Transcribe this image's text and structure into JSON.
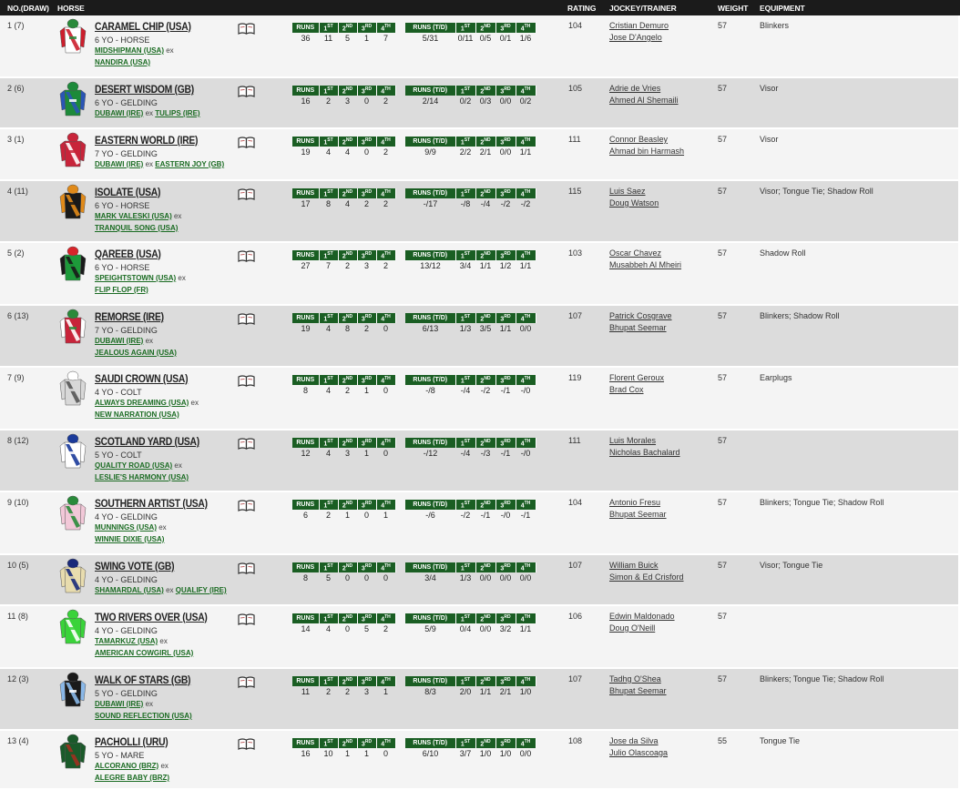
{
  "headers": {
    "no": "NO.(DRAW)",
    "horse": "HORSE",
    "rating": "RATING",
    "jockey": "JOCKEY/TRAINER",
    "weight": "WEIGHT",
    "equipment": "EQUIPMENT"
  },
  "stat_headers": {
    "runs": "RUNS",
    "runs_td": "RUNS (T/D)",
    "first": "1",
    "second": "2",
    "third": "3",
    "fourth": "4",
    "first_sup": "ST",
    "second_sup": "ND",
    "third_sup": "RD",
    "fourth_sup": "TH"
  },
  "sire_dam_joiner": "ex",
  "runners": [
    {
      "no": "1 (7)",
      "name": "CARAMEL CHIP (USA)",
      "age": "6 YO - HORSE",
      "sire": "MIDSHIPMAN (USA)",
      "dam": "NANDIRA (USA)",
      "split": true,
      "stats": [
        "36",
        "11",
        "5",
        "1",
        "7"
      ],
      "td": [
        "5/31",
        "0/11",
        "0/5",
        "0/1",
        "1/6"
      ],
      "rating": "104",
      "jockey": "Cristian Demuro",
      "trainer": "Jose D'Angelo",
      "weight": "57",
      "equipment": "Blinkers",
      "silk": {
        "body": "#ffffff",
        "accent": "#cc1f2d",
        "accent2": "#2a8a3a",
        "cap": "#2a8a3a",
        "arms": "#cc1f2d"
      }
    },
    {
      "no": "2 (6)",
      "name": "DESERT WISDOM (GB)",
      "age": "6 YO - GELDING",
      "sire": "DUBAWI (IRE)",
      "dam": "TULIPS (IRE)",
      "split": false,
      "stats": [
        "16",
        "2",
        "3",
        "0",
        "2"
      ],
      "td": [
        "2/14",
        "0/2",
        "0/3",
        "0/0",
        "0/2"
      ],
      "rating": "105",
      "jockey": "Adrie de Vries",
      "trainer": "Ahmed Al Shemaili",
      "weight": "57",
      "equipment": "Visor",
      "silk": {
        "body": "#1d8a3a",
        "accent": "#2a55b5",
        "accent2": "#ffffff",
        "cap": "#1d8a3a",
        "arms": "#2a55b5"
      }
    },
    {
      "no": "3 (1)",
      "name": "EASTERN WORLD (IRE)",
      "age": "7 YO - GELDING",
      "sire": "DUBAWI (IRE)",
      "dam": "EASTERN JOY (GB)",
      "split": false,
      "stats": [
        "19",
        "4",
        "4",
        "0",
        "2"
      ],
      "td": [
        "9/9",
        "2/2",
        "2/1",
        "0/0",
        "1/1"
      ],
      "rating": "111",
      "jockey": "Connor Beasley",
      "trainer": "Ahmad bin Harmash",
      "weight": "57",
      "equipment": "Visor",
      "silk": {
        "body": "#c8243a",
        "accent": "#ffffff",
        "accent2": "#c8243a",
        "cap": "#c8243a",
        "arms": "#c8243a"
      }
    },
    {
      "no": "4 (11)",
      "name": "ISOLATE (USA)",
      "age": "6 YO - HORSE",
      "sire": "MARK VALESKI (USA)",
      "dam": "TRANQUIL SONG (USA)",
      "split": true,
      "stats": [
        "17",
        "8",
        "4",
        "2",
        "2"
      ],
      "td": [
        "-/17",
        "-/8",
        "-/4",
        "-/2",
        "-/2"
      ],
      "rating": "115",
      "jockey": "Luis Saez",
      "trainer": "Doug Watson",
      "weight": "57",
      "equipment": "Visor; Tongue Tie; Shadow Roll",
      "silk": {
        "body": "#1a1a1a",
        "accent": "#e08a1a",
        "accent2": "#1a1a1a",
        "cap": "#e08a1a",
        "arms": "#e08a1a"
      }
    },
    {
      "no": "5 (2)",
      "name": "QAREEB (USA)",
      "age": "6 YO - HORSE",
      "sire": "SPEIGHTSTOWN (USA)",
      "dam": "FLIP FLOP (FR)",
      "split": true,
      "stats": [
        "27",
        "7",
        "2",
        "3",
        "2"
      ],
      "td": [
        "13/12",
        "3/4",
        "1/1",
        "1/2",
        "1/1"
      ],
      "rating": "103",
      "jockey": "Oscar Chavez",
      "trainer": "Musabbeh Al Mheiri",
      "weight": "57",
      "equipment": "Shadow Roll",
      "silk": {
        "body": "#1d9a3a",
        "accent": "#1a1a1a",
        "accent2": "#1d9a3a",
        "cap": "#d8242a",
        "arms": "#1a1a1a"
      }
    },
    {
      "no": "6 (13)",
      "name": "REMORSE (IRE)",
      "age": "7 YO - GELDING",
      "sire": "DUBAWI (IRE)",
      "dam": "JEALOUS AGAIN (USA)",
      "split": true,
      "stats": [
        "19",
        "4",
        "8",
        "2",
        "0"
      ],
      "td": [
        "6/13",
        "1/3",
        "3/5",
        "1/1",
        "0/0"
      ],
      "rating": "107",
      "jockey": "Patrick Cosgrave",
      "trainer": "Bhupat Seemar",
      "weight": "57",
      "equipment": "Blinkers; Shadow Roll",
      "silk": {
        "body": "#c8243a",
        "accent": "#ffffff",
        "accent2": "#2a8a3a",
        "cap": "#2a8a3a",
        "arms": "#ffffff"
      }
    },
    {
      "no": "7 (9)",
      "name": "SAUDI CROWN (USA)",
      "age": "4 YO - COLT",
      "sire": "ALWAYS DREAMING (USA)",
      "dam": "NEW NARRATION (USA)",
      "split": true,
      "stats": [
        "8",
        "4",
        "2",
        "1",
        "0"
      ],
      "td": [
        "-/8",
        "-/4",
        "-/2",
        "-/1",
        "-/0"
      ],
      "rating": "119",
      "jockey": "Florent Geroux",
      "trainer": "Brad Cox",
      "weight": "57",
      "equipment": "Earplugs",
      "silk": {
        "body": "#d8d8d8",
        "accent": "#555555",
        "accent2": "#d8d8d8",
        "cap": "#ffffff",
        "arms": "#d8d8d8"
      }
    },
    {
      "no": "8 (12)",
      "name": "SCOTLAND YARD (USA)",
      "age": "5 YO - COLT",
      "sire": "QUALITY ROAD (USA)",
      "dam": "LESLIE'S HARMONY (USA)",
      "split": true,
      "stats": [
        "12",
        "4",
        "3",
        "1",
        "0"
      ],
      "td": [
        "-/12",
        "-/4",
        "-/3",
        "-/1",
        "-/0"
      ],
      "rating": "111",
      "jockey": "Luis Morales",
      "trainer": "Nicholas Bachalard",
      "weight": "57",
      "equipment": "",
      "silk": {
        "body": "#ffffff",
        "accent": "#1a3a9a",
        "accent2": "#ffffff",
        "cap": "#1a3a9a",
        "arms": "#ffffff"
      }
    },
    {
      "no": "9 (10)",
      "name": "SOUTHERN ARTIST (USA)",
      "age": "4 YO - GELDING",
      "sire": "MUNNINGS (USA)",
      "dam": "WINNIE DIXIE (USA)",
      "split": true,
      "stats": [
        "6",
        "2",
        "1",
        "0",
        "1"
      ],
      "td": [
        "-/6",
        "-/2",
        "-/1",
        "-/0",
        "-/1"
      ],
      "rating": "104",
      "jockey": "Antonio Fresu",
      "trainer": "Bhupat Seemar",
      "weight": "57",
      "equipment": "Blinkers; Tongue Tie; Shadow Roll",
      "silk": {
        "body": "#f2c8d8",
        "accent": "#2a8a3a",
        "accent2": "#f2c8d8",
        "cap": "#2a8a3a",
        "arms": "#f2c8d8"
      }
    },
    {
      "no": "10 (5)",
      "name": "SWING VOTE (GB)",
      "age": "4 YO - GELDING",
      "sire": "SHAMARDAL (USA)",
      "dam": "QUALIFY (IRE)",
      "split": false,
      "stats": [
        "8",
        "5",
        "0",
        "0",
        "0"
      ],
      "td": [
        "3/4",
        "1/3",
        "0/0",
        "0/0",
        "0/0"
      ],
      "rating": "107",
      "jockey": "William Buick",
      "trainer": "Simon & Ed Crisford",
      "weight": "57",
      "equipment": "Visor; Tongue Tie",
      "silk": {
        "body": "#e8dcae",
        "accent": "#1a2a7a",
        "accent2": "#e8dcae",
        "cap": "#1a2a7a",
        "arms": "#e8dcae"
      }
    },
    {
      "no": "11 (8)",
      "name": "TWO RIVERS OVER (USA)",
      "age": "4 YO - GELDING",
      "sire": "TAMARKUZ (USA)",
      "dam": "AMERICAN COWGIRL (USA)",
      "split": true,
      "stats": [
        "14",
        "4",
        "0",
        "5",
        "2"
      ],
      "td": [
        "5/9",
        "0/4",
        "0/0",
        "3/2",
        "1/1"
      ],
      "rating": "106",
      "jockey": "Edwin Maldonado",
      "trainer": "Doug O'Neill",
      "weight": "57",
      "equipment": "",
      "silk": {
        "body": "#3ad33a",
        "accent": "#ffffff",
        "accent2": "#3ad33a",
        "cap": "#3ad33a",
        "arms": "#3ad33a"
      }
    },
    {
      "no": "12 (3)",
      "name": "WALK OF STARS (GB)",
      "age": "5 YO - GELDING",
      "sire": "DUBAWI (IRE)",
      "dam": "SOUND REFLECTION (USA)",
      "split": true,
      "stats": [
        "11",
        "2",
        "2",
        "3",
        "1"
      ],
      "td": [
        "8/3",
        "2/0",
        "1/1",
        "2/1",
        "1/0"
      ],
      "rating": "107",
      "jockey": "Tadhg O'Shea",
      "trainer": "Bhupat Seemar",
      "weight": "57",
      "equipment": "Blinkers; Tongue Tie; Shadow Roll",
      "silk": {
        "body": "#1a1a1a",
        "accent": "#8ab8e8",
        "accent2": "#ffffff",
        "cap": "#1a1a1a",
        "arms": "#8ab8e8"
      }
    },
    {
      "no": "13 (4)",
      "name": "PACHOLLI (URU)",
      "age": "5 YO - MARE",
      "sire": "ALCORANO (BRZ)",
      "dam": "ALEGRE BABY (BRZ)",
      "split": true,
      "stats": [
        "16",
        "10",
        "1",
        "1",
        "0"
      ],
      "td": [
        "6/10",
        "3/7",
        "1/0",
        "1/0",
        "0/0"
      ],
      "rating": "108",
      "jockey": "Jose da Silva",
      "trainer": "Julio Olascoaga",
      "weight": "55",
      "equipment": "Tongue Tie",
      "silk": {
        "body": "#1a5a2a",
        "accent": "#a03020",
        "accent2": "#1a5a2a",
        "cap": "#1a5a2a",
        "arms": "#1a5a2a"
      }
    }
  ]
}
